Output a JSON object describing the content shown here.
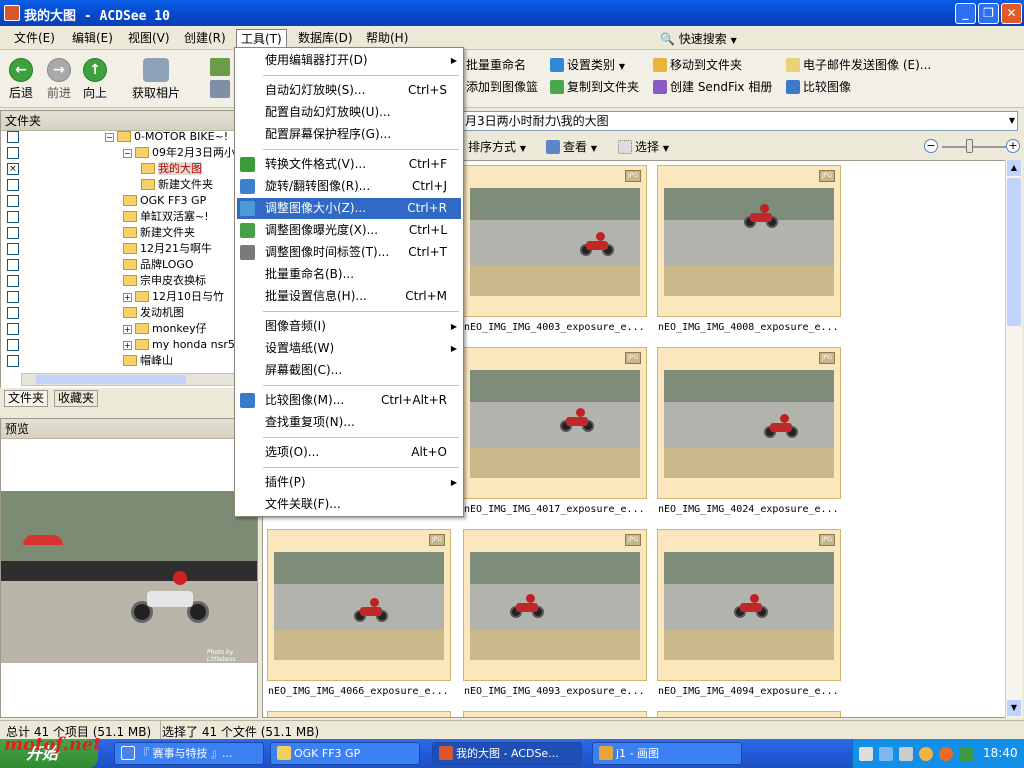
{
  "window": {
    "title": "我的大图 - ACDSee 10"
  },
  "menubar": {
    "items": [
      "文件(E)",
      "编辑(E)",
      "视图(V)",
      "创建(R)",
      "工具(T)",
      "数据库(D)",
      "帮助(H)"
    ],
    "quick_search": "快速搜索"
  },
  "toolbar": {
    "back": "后退",
    "forward": "前进",
    "up": "向上",
    "acquire": "获取相片",
    "batch_rename": "批量重命名",
    "set_category": "设置类别",
    "move_to": "移动到文件夹",
    "email": "电子邮件发送图像 (E)...",
    "add_basket": "添加到图像篮",
    "copy_to": "复制到文件夹",
    "sendfix": "创建 SendFix 相册",
    "compare": "比较图像"
  },
  "path": {
    "text": "月3日两小时耐力\\我的大图"
  },
  "viewbar": {
    "sort": "排序方式",
    "view": "查看",
    "select": "选择"
  },
  "folders": {
    "header": "文件夹",
    "rows": [
      {
        "label": "0-MOTOR BIKE~!"
      },
      {
        "label": "09年2月3日两小"
      },
      {
        "label": "我的大图"
      },
      {
        "label": "新建文件夹"
      },
      {
        "label": "OGK FF3 GP"
      },
      {
        "label": "单缸双活塞~!"
      },
      {
        "label": "新建文件夹"
      },
      {
        "label": "12月21与啊牛"
      },
      {
        "label": "品牌LOGO"
      },
      {
        "label": "宗申皮衣换标"
      },
      {
        "label": "12月10日与竹"
      },
      {
        "label": "发动机图"
      },
      {
        "label": "monkey仔"
      },
      {
        "label": "my honda nsr5"
      },
      {
        "label": "帽峰山"
      }
    ],
    "tab_folders": "文件夹",
    "tab_favorites": "收藏夹"
  },
  "preview": {
    "header": "预览",
    "caption": "Photo by Littleboss"
  },
  "thumbnails": [
    {
      "name": "nEO_IMG_IMG_4003_exposure_e..."
    },
    {
      "name": "nEO_IMG_IMG_4008_exposure_e..."
    },
    {
      "name": "nEO_IMG_IMG_4017_exposure_e..."
    },
    {
      "name": "nEO_IMG_IMG_4024_exposure_e..."
    },
    {
      "name": "nEO_IMG_IMG_4066_exposure_e..."
    },
    {
      "name": "nEO_IMG_IMG_4093_exposure_e..."
    },
    {
      "name": "nEO_IMG_IMG_4094_exposure_e..."
    }
  ],
  "thumb_badge": "JPG",
  "statusbar": {
    "total": "总计 41 个项目 (51.1 MB)",
    "selected": "选择了 41 个文件 (51.1 MB)"
  },
  "toolmenu": {
    "items": [
      {
        "label": "使用编辑器打开(D)",
        "shortcut": "",
        "submenu": true
      },
      {
        "label": "自动幻灯放映(S)...",
        "shortcut": "Ctrl+S"
      },
      {
        "label": "配置自动幻灯放映(U)...",
        "shortcut": ""
      },
      {
        "label": "配置屏幕保护程序(G)...",
        "shortcut": ""
      },
      {
        "label": "转换文件格式(V)...",
        "shortcut": "Ctrl+F"
      },
      {
        "label": "旋转/翻转图像(R)...",
        "shortcut": "Ctrl+J"
      },
      {
        "label": "调整图像大小(Z)...",
        "shortcut": "Ctrl+R"
      },
      {
        "label": "调整图像曝光度(X)...",
        "shortcut": "Ctrl+L"
      },
      {
        "label": "调整图像时间标签(T)...",
        "shortcut": "Ctrl+T"
      },
      {
        "label": "批量重命名(B)...",
        "shortcut": ""
      },
      {
        "label": "批量设置信息(H)...",
        "shortcut": "Ctrl+M"
      },
      {
        "label": "图像音频(I)",
        "shortcut": "",
        "submenu": true
      },
      {
        "label": "设置墙纸(W)",
        "shortcut": "",
        "submenu": true
      },
      {
        "label": "屏幕截图(C)...",
        "shortcut": ""
      },
      {
        "label": "比较图像(M)...",
        "shortcut": "Ctrl+Alt+R"
      },
      {
        "label": "查找重复项(N)...",
        "shortcut": ""
      },
      {
        "label": "选项(O)...",
        "shortcut": "Alt+O"
      },
      {
        "label": "插件(P)",
        "shortcut": "",
        "submenu": true
      },
      {
        "label": "文件关联(F)...",
        "shortcut": ""
      }
    ]
  },
  "taskbar": {
    "start": "开始",
    "tasks": [
      "『 赛事与特技 』...",
      "OGK FF3 GP",
      "我的大图 - ACDSe...",
      "j1 - 画图"
    ],
    "clock": "18:40"
  },
  "watermark": "motof.net",
  "colors": {
    "accent": "#316ac5",
    "titlebar": "#0a5ee8",
    "thumb_bg": "#fbe7bd"
  }
}
